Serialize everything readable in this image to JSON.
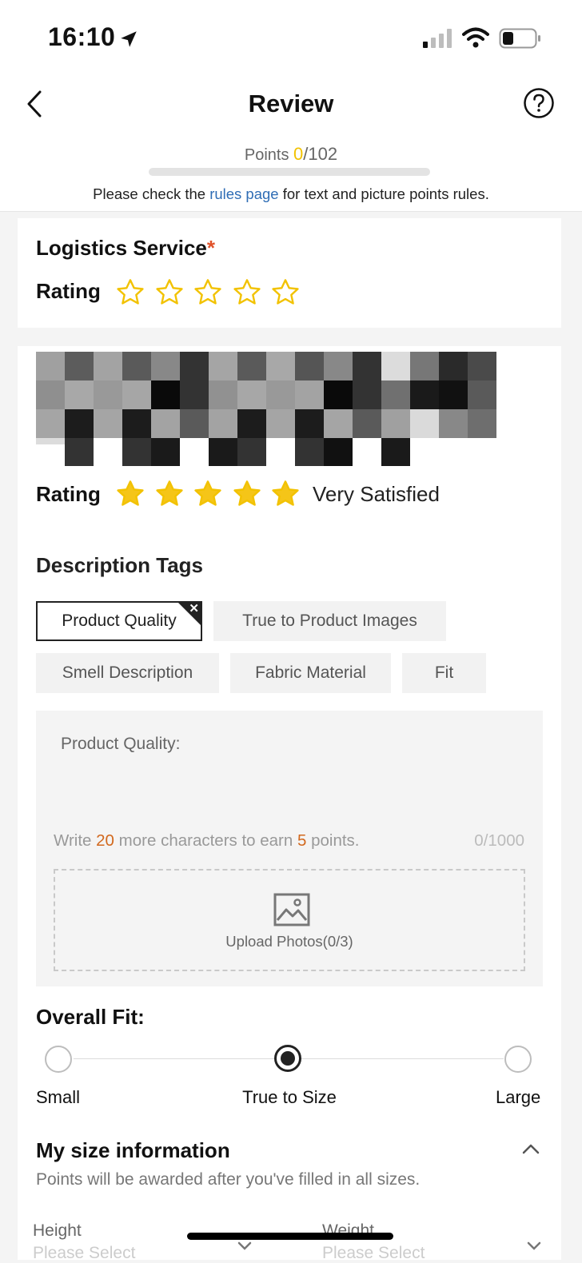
{
  "status": {
    "time": "16:10"
  },
  "header": {
    "title": "Review",
    "points_label": "Points",
    "points_current": "0",
    "points_max": "/102",
    "points_progress": 0,
    "rules_prefix": "Please check the ",
    "rules_link": "rules page",
    "rules_suffix": " for text and picture points rules."
  },
  "logistics": {
    "title": "Logistics Service",
    "required_mark": "*",
    "rating_label": "Rating",
    "stars_filled": 0,
    "stars_total": 5
  },
  "product": {
    "rating_label": "Rating",
    "stars_filled": 5,
    "stars_total": 5,
    "rating_text": "Very Satisfied"
  },
  "tags": {
    "title": "Description Tags",
    "items": [
      "Product Quality",
      "True to Product Images",
      "Smell Description",
      "Fabric Material",
      "Fit"
    ],
    "selected": "Product Quality"
  },
  "textarea": {
    "label": "Product Quality:",
    "hint_prefix": "Write ",
    "hint_chars": "20",
    "hint_middle": " more characters to earn ",
    "hint_points": "5",
    "hint_suffix": " points.",
    "counter": "0/1000"
  },
  "upload": {
    "label": "Upload Photos(0/3)"
  },
  "overall_fit": {
    "title": "Overall Fit:",
    "options": [
      "Small",
      "True to Size",
      "Large"
    ],
    "selected": "True to Size"
  },
  "size_info": {
    "title": "My size information",
    "subtitle": "Points will be awarded after you've filled in all sizes.",
    "height_label": "Height",
    "weight_label": "Weight",
    "placeholder": "Please Select"
  },
  "colors": {
    "accent_yellow": "#f2c200",
    "link_blue": "#2f6db5",
    "hint_orange": "#d2691e",
    "required_red": "#e0522a"
  }
}
